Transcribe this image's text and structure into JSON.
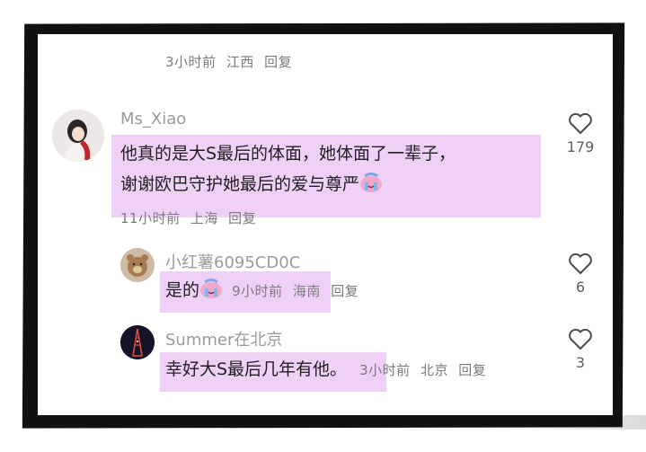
{
  "top_reply_meta": {
    "time": "3小时前",
    "location": "江西",
    "reply": "回复"
  },
  "comments": [
    {
      "username": "Ms_Xiao",
      "text_line1": "他真的是大S最后的体面，她体面了一辈子，",
      "text_line2": "谢谢欧巴守护她最后的爱与尊严",
      "emoji": "crying-face-emoji",
      "time": "11小时前",
      "location": "上海",
      "reply": "回复",
      "likes": "179"
    },
    {
      "username": "小红薯6095CD0C",
      "text": "是的",
      "emoji": "crying-face-emoji",
      "time": "9小时前",
      "location": "海南",
      "reply": "回复",
      "likes": "6"
    },
    {
      "username": "Summer在北京",
      "text": "幸好大S最后几年有他。",
      "time": "3小时前",
      "location": "北京",
      "reply": "回复",
      "likes": "3"
    }
  ],
  "colors": {
    "highlight": "#ecc9f6",
    "text": "#1f1f1f",
    "muted": "#8d8d8d",
    "frame": "#111111"
  },
  "icons": [
    "heart-outline-icon",
    "crying-face-emoji"
  ]
}
